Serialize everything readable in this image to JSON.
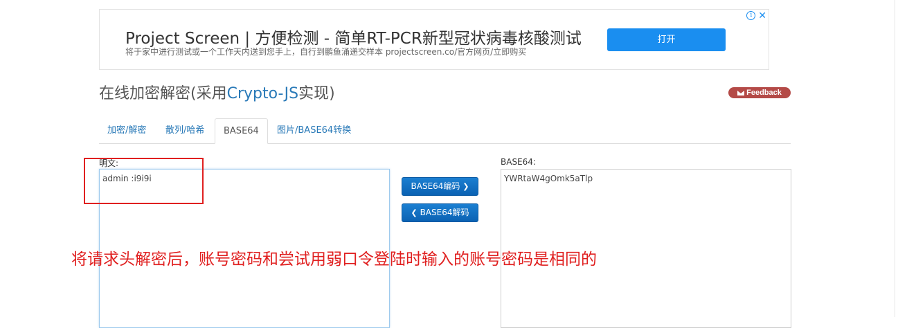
{
  "ad": {
    "title": "Project Screen | 方便检测 - 简单RT-PCR新型冠状病毒核酸测试",
    "subtitle": "将于家中进行测试或一个工作天内送到您手上，自行到鹏鱼涌递交样本 projectscreen.co/官方网页/立即购买",
    "open_label": "打开",
    "info_glyph": "i",
    "close_glyph": "✕"
  },
  "page": {
    "title_prefix": "在线加密解密(采用",
    "title_accent": "Crypto-JS",
    "title_suffix": "实现)",
    "feedback_label": "Feedback"
  },
  "tabs": [
    {
      "label": "加密/解密"
    },
    {
      "label": "散列/哈希"
    },
    {
      "label": "BASE64",
      "active": true
    },
    {
      "label": "图片/BASE64转换"
    }
  ],
  "form": {
    "plain_label": "明文:",
    "plain_value": "admin :i9i9i",
    "base64_label": "BASE64:",
    "base64_value": "YWRtaW4gOmk5aTlp",
    "encode_label": "BASE64编码",
    "decode_label": "BASE64解码"
  },
  "annotation": {
    "text": "将请求头解密后，账号密码和尝试用弱口令登陆时输入的账号密码是相同的"
  },
  "colors": {
    "accent": "#2a7ab8",
    "button": "#0b62b3",
    "annotation": "#e02020",
    "feedback": "#b44a47"
  }
}
